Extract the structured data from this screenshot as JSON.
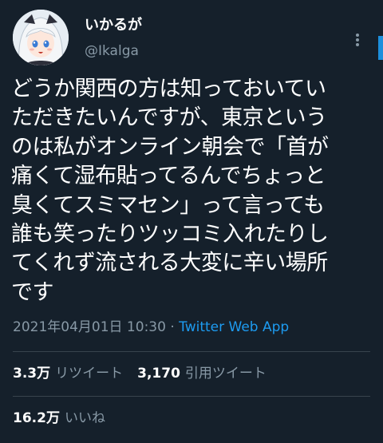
{
  "tweet": {
    "author": {
      "display_name": "いかるが",
      "handle": "@Ikalga",
      "avatar": "anime-avatar"
    },
    "more_icon": "more-vertical-icon",
    "text_lines": [
      "どうか関西の方は知っておいてい",
      "ただきたいんですが、東京という",
      "のは私がオンライン朝会で「首が",
      "痛くて湿布貼ってるんでちょっと",
      "臭くてスミマセン」って言っても",
      "誰も笑ったりツッコミ入れたりし",
      "てくれず流される大変に辛い場所",
      "です"
    ],
    "timestamp": "2021年04月01日 10:30",
    "separator": " · ",
    "source_app": "Twitter Web App",
    "stats": {
      "retweets_count": "3.3万",
      "retweets_label": "リツイート",
      "quotes_count": "3,170",
      "quotes_label": "引用ツイート",
      "likes_count": "16.2万",
      "likes_label": "いいね"
    }
  },
  "colors": {
    "background": "#15202b",
    "text": "#ffffff",
    "secondary": "#8899a6",
    "accent": "#1d9bf0",
    "divider": "#38444d"
  }
}
